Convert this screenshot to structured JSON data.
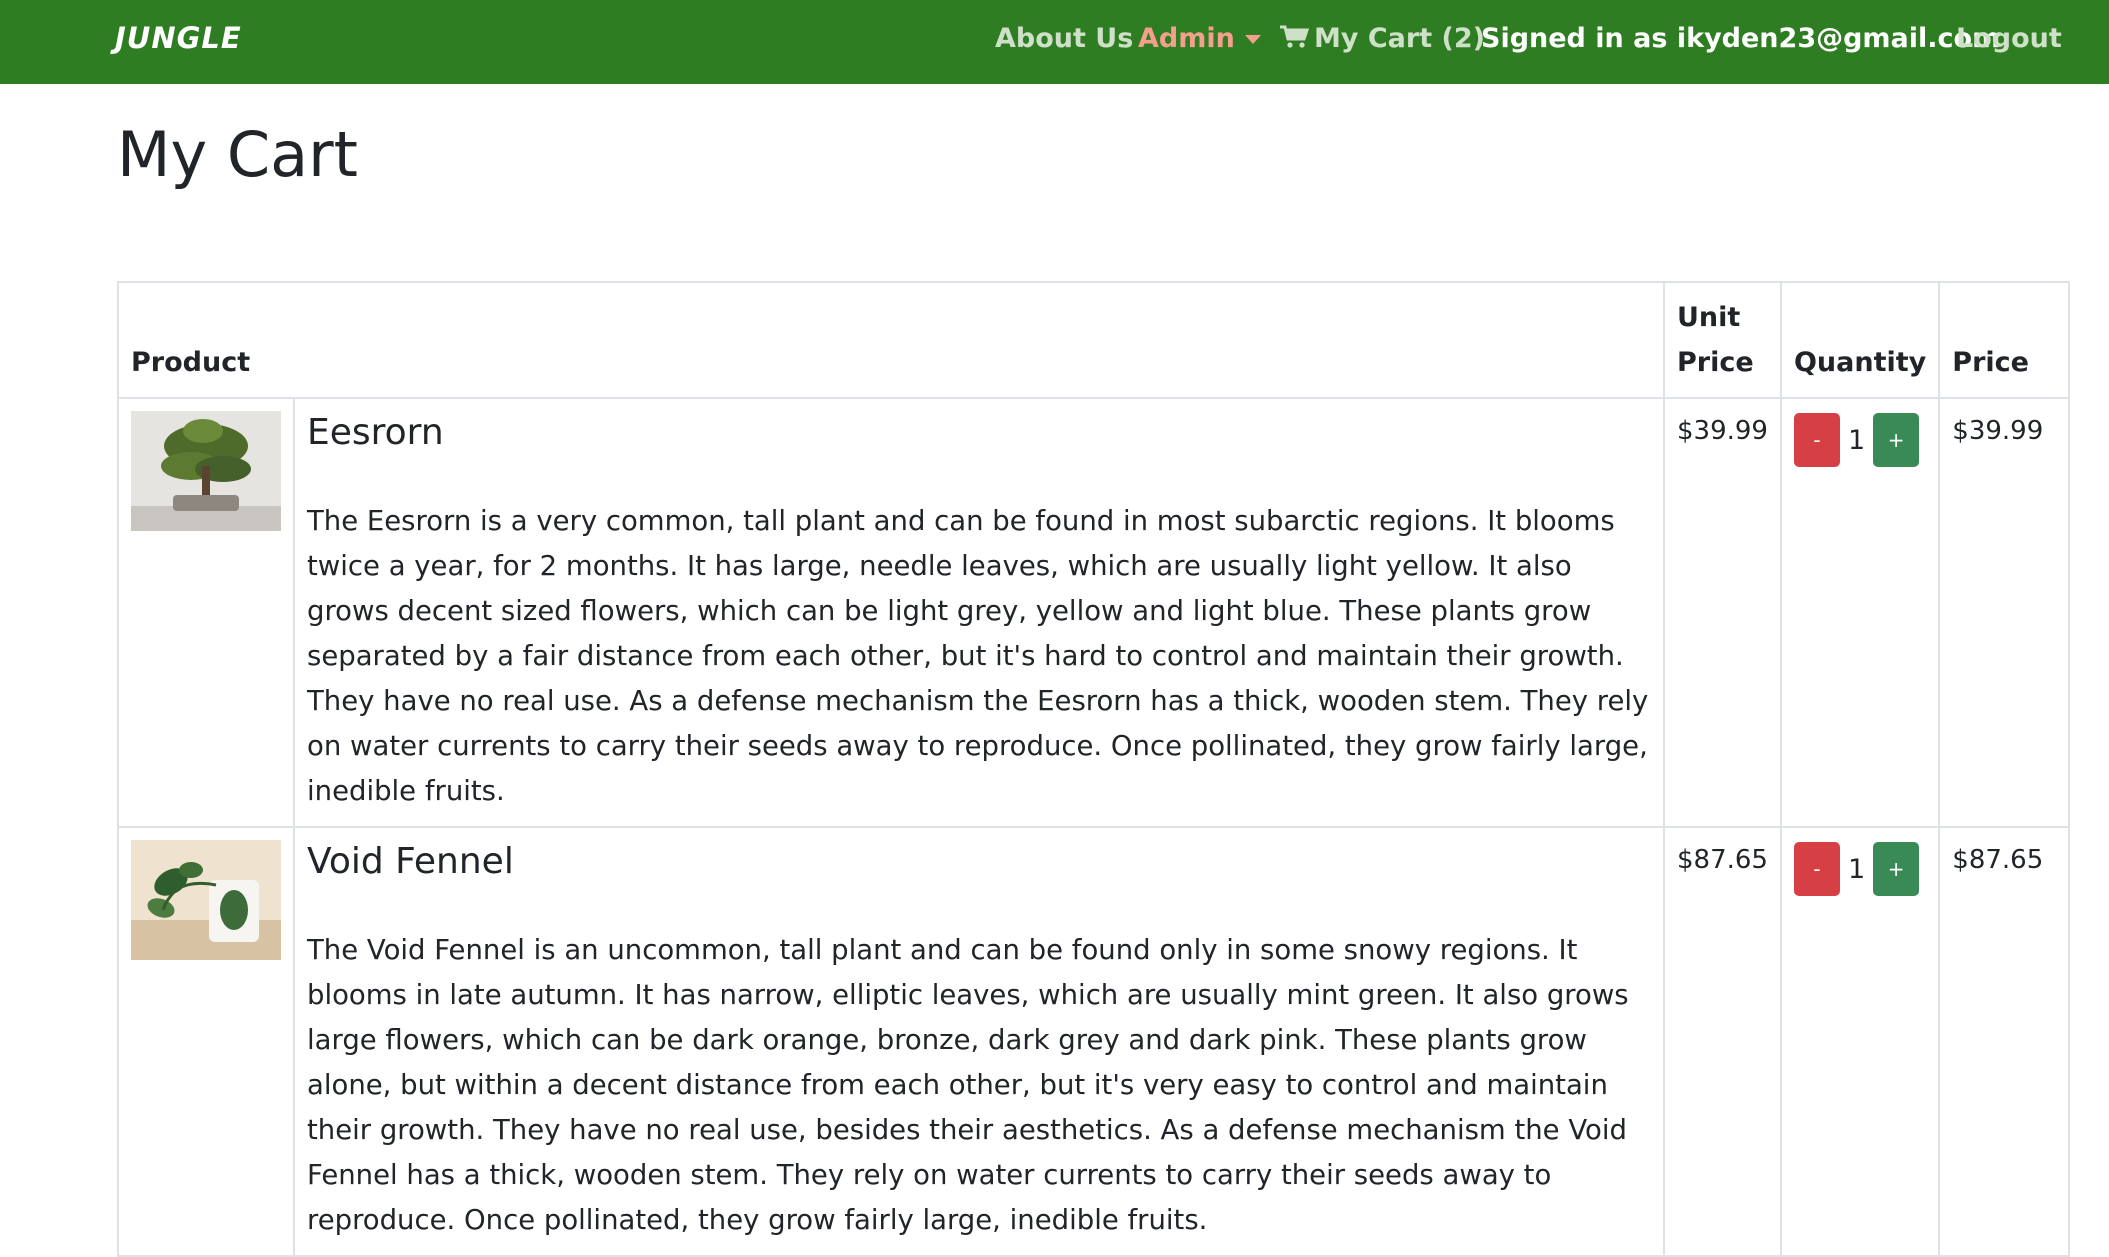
{
  "navbar": {
    "brand": "JUNGLE",
    "about": "About Us",
    "admin": "Admin",
    "cart": "My Cart (2)",
    "signed_in": "Signed in as ikyden23@gmail.com",
    "logout": "Logout",
    "colors": {
      "bg": "#2f7d22",
      "link": "#cfe0c8",
      "admin": "#f5a08c"
    }
  },
  "page": {
    "title": "My Cart"
  },
  "table": {
    "headers": {
      "product": "Product",
      "unit_price": "Unit Price",
      "quantity": "Quantity",
      "price": "Price"
    },
    "rows": [
      {
        "name": "Eesrorn",
        "description": "The Eesrorn is a very common, tall plant and can be found in most subarctic regions. It blooms twice a year, for 2 months. It has large, needle leaves, which are usually light yellow. It also grows decent sized flowers, which can be light grey, yellow and light blue. These plants grow separated by a fair distance from each other, but it's hard to control and maintain their growth. They have no real use. As a defense mechanism the Eesrorn has a thick, wooden stem. They rely on water currents to carry their seeds away to reproduce. Once pollinated, they grow fairly large, inedible fruits.",
        "unit_price": "$39.99",
        "minus": "-",
        "quantity": "1",
        "plus": "+",
        "price": "$39.99",
        "image": "bonsai-plant-photo"
      },
      {
        "name": "Void Fennel",
        "description": "The Void Fennel is an uncommon, tall plant and can be found only in some snowy regions. It blooms in late autumn. It has narrow, elliptic leaves, which are usually mint green. It also grows large flowers, which can be dark orange, bronze, dark grey and dark pink. These plants grow alone, but within a decent distance from each other, but it's very easy to control and maintain their growth. They have no real use, besides their aesthetics. As a defense mechanism the Void Fennel has a thick, wooden stem. They rely on water currents to carry their seeds away to reproduce. Once pollinated, they grow fairly large, inedible fruits.",
        "unit_price": "$87.65",
        "minus": "-",
        "quantity": "1",
        "plus": "+",
        "price": "$87.65",
        "image": "potted-vine-plant-photo"
      }
    ]
  },
  "colors": {
    "minus_button": "#d64045",
    "plus_button": "#3a8a55",
    "border": "#dee2e6"
  }
}
